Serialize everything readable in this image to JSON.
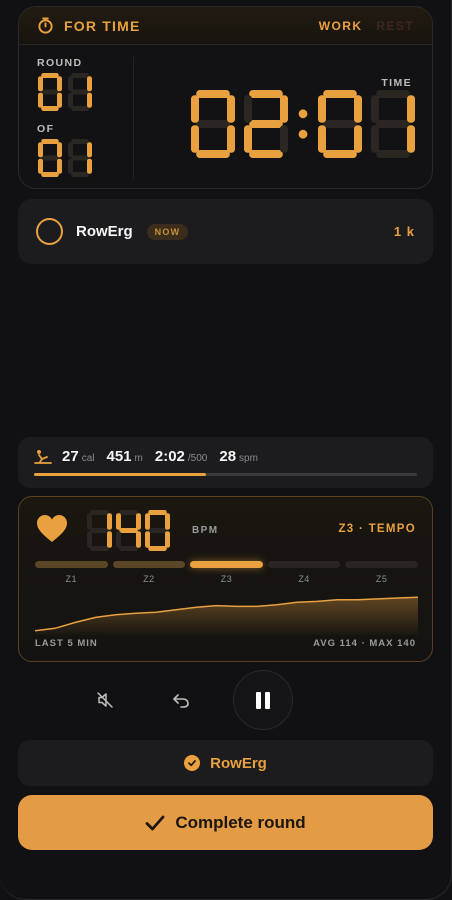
{
  "timer": {
    "mode": "FOR TIME",
    "work_label": "WORK",
    "rest_label": "REST",
    "round_label": "ROUND",
    "round_value": "01",
    "of_label": "OF",
    "of_value": "01",
    "time_label": "TIME",
    "time_value": "02:01"
  },
  "exercise": {
    "name": "RowErg",
    "badge": "NOW",
    "target": "1 k"
  },
  "stats": {
    "calories": "27",
    "calories_unit": "cal",
    "meters": "451",
    "meters_unit": "m",
    "pace": "2:02",
    "pace_unit": "/500",
    "rate": "28",
    "rate_unit": "spm",
    "progress": 0.45
  },
  "heart": {
    "bpm": "140",
    "bpm_label": "BPM",
    "zone_label": "Z3 · TEMPO",
    "zones": [
      "Z1",
      "Z2",
      "Z3",
      "Z4",
      "Z5"
    ],
    "active_zone": 2,
    "window_label": "LAST 5 MIN",
    "summary": "AVG 114 · MAX 140",
    "history": [
      100,
      103,
      110,
      116,
      119,
      121,
      122,
      125,
      128,
      130,
      129,
      129,
      131,
      134,
      135,
      137,
      137,
      138,
      139,
      140
    ]
  },
  "controls": {
    "mute_icon": "speaker-muted-icon",
    "undo_icon": "undo-icon",
    "pause_icon": "pause-icon"
  },
  "done_chip": {
    "label": "RowErg"
  },
  "complete_button": {
    "label": "Complete round"
  },
  "colors": {
    "accent": "#e9a13f",
    "background": "#111113",
    "card": "#1c1c1f"
  }
}
